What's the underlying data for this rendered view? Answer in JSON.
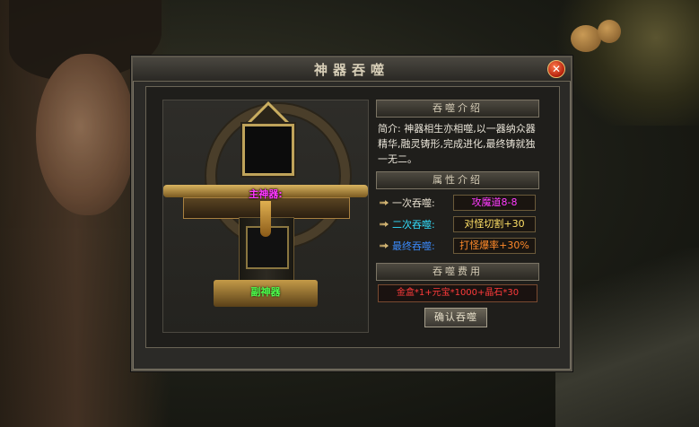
{
  "dialog": {
    "title": "神器吞噬",
    "close_symbol": "✕"
  },
  "altar": {
    "main_label": "主神器:",
    "sub_label": "副神器"
  },
  "sections": {
    "intro_header": "吞噬介绍",
    "intro_text": "简介: 神器相生亦相噬,以一器纳众器精华,融灵铸形,完成进化,最终铸就独一无二。",
    "attr_header": "属性介绍",
    "cost_header": "吞噬费用"
  },
  "attributes": [
    {
      "label": "一次吞噬:",
      "value": "攻魔道8-8",
      "label_color": "#e8e0d0",
      "value_color": "#ff3bff"
    },
    {
      "label": "二次吞噬:",
      "value": "对怪切割+30",
      "label_color": "#33e0ff",
      "value_color": "#ffe066"
    },
    {
      "label": "最终吞噬:",
      "value": "打怪爆率+30%",
      "label_color": "#3b8cff",
      "value_color": "#ff8a2a"
    }
  ],
  "cost": "金盒*1+元宝*1000+晶石*30",
  "confirm_label": "确认吞噬"
}
